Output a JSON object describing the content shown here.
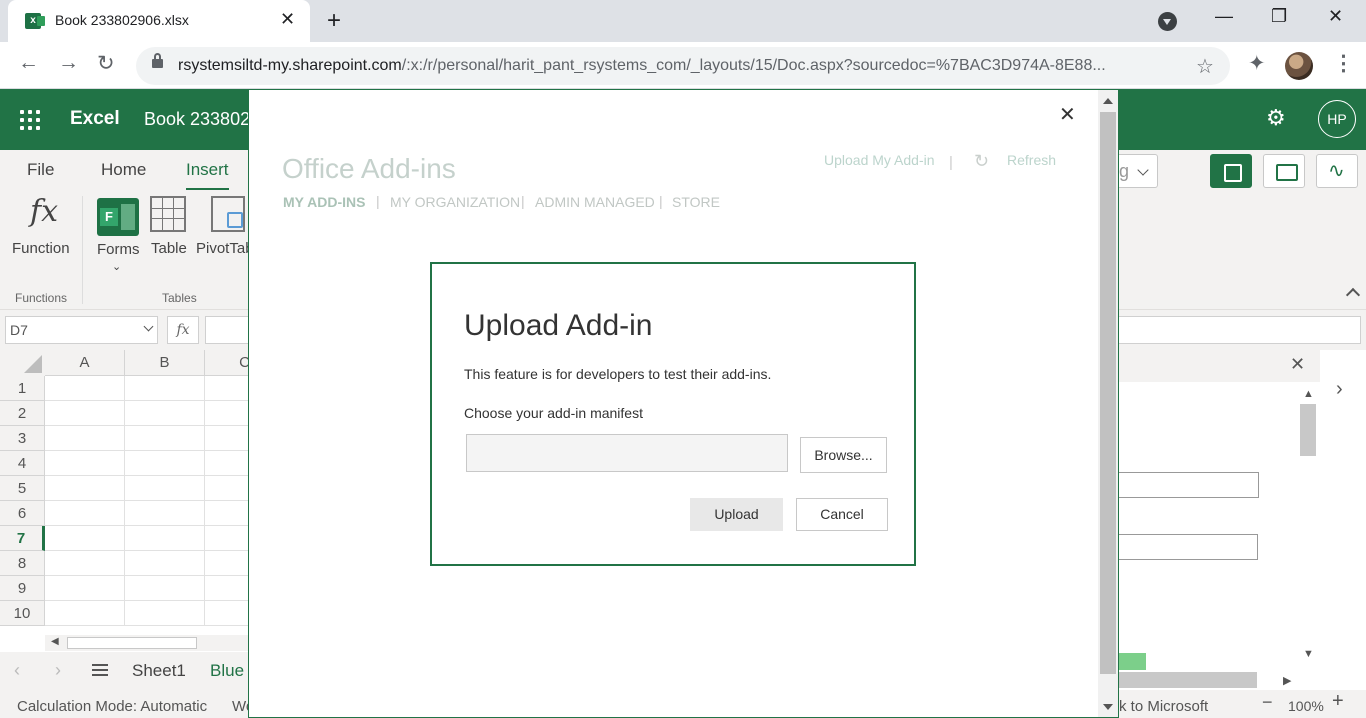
{
  "browser": {
    "tab_title": "Book 233802906.xlsx",
    "url_host": "rsystemsiltd-my.sharepoint.com",
    "url_path": "/:x:/r/personal/harit_pant_rsystems_com/_layouts/15/Doc.aspx?sourcedoc=%7BAC3D974A-8E88..."
  },
  "excel": {
    "app_name": "Excel",
    "doc_name": "Book 233802",
    "user_initials": "HP",
    "ribbon_tabs": [
      "File",
      "Home",
      "Insert"
    ],
    "active_tab": "Insert",
    "ribbon_items": {
      "function": "Function",
      "forms": "Forms",
      "table": "Table",
      "pivot": "PivotTab"
    },
    "groups": {
      "functions": "Functions",
      "tables": "Tables"
    },
    "name_box": "D7",
    "fx_label": "fx",
    "view_dd_partial": "g",
    "columns": [
      "A",
      "B",
      "C"
    ],
    "rows": [
      "1",
      "2",
      "3",
      "4",
      "5",
      "6",
      "7",
      "8",
      "9",
      "10"
    ],
    "active_row": "7",
    "sheets": [
      "Sheet1",
      "Blue"
    ],
    "status_left": "Calculation Mode: Automatic",
    "status_wo": "Wo",
    "status_right": "k to Microsoft",
    "zoom": "100%"
  },
  "addins": {
    "title": "Office Add-ins",
    "upload_link": "Upload My Add-in",
    "refresh_link": "Refresh",
    "nav": [
      "MY ADD-INS",
      "MY ORGANIZATION",
      "ADMIN MANAGED",
      "STORE"
    ],
    "active_nav": "MY ADD-INS"
  },
  "upload_dialog": {
    "title": "Upload Add-in",
    "description": "This feature is for developers to test their add-ins.",
    "choose_label": "Choose your add-in manifest",
    "file_value": "",
    "browse_label": "Browse...",
    "upload_label": "Upload",
    "cancel_label": "Cancel"
  },
  "colors": {
    "excel_green": "#217346",
    "chrome_bg": "#dee1e6",
    "ribbon_bg": "#f3f2f1"
  },
  "icons": [
    "excel-favicon",
    "close-icon",
    "plus-icon",
    "back-icon",
    "forward-icon",
    "reload-icon",
    "lock-icon",
    "star-icon",
    "extensions-icon",
    "menu-dots-icon",
    "waffle-icon",
    "gear-icon",
    "refresh-icon"
  ]
}
